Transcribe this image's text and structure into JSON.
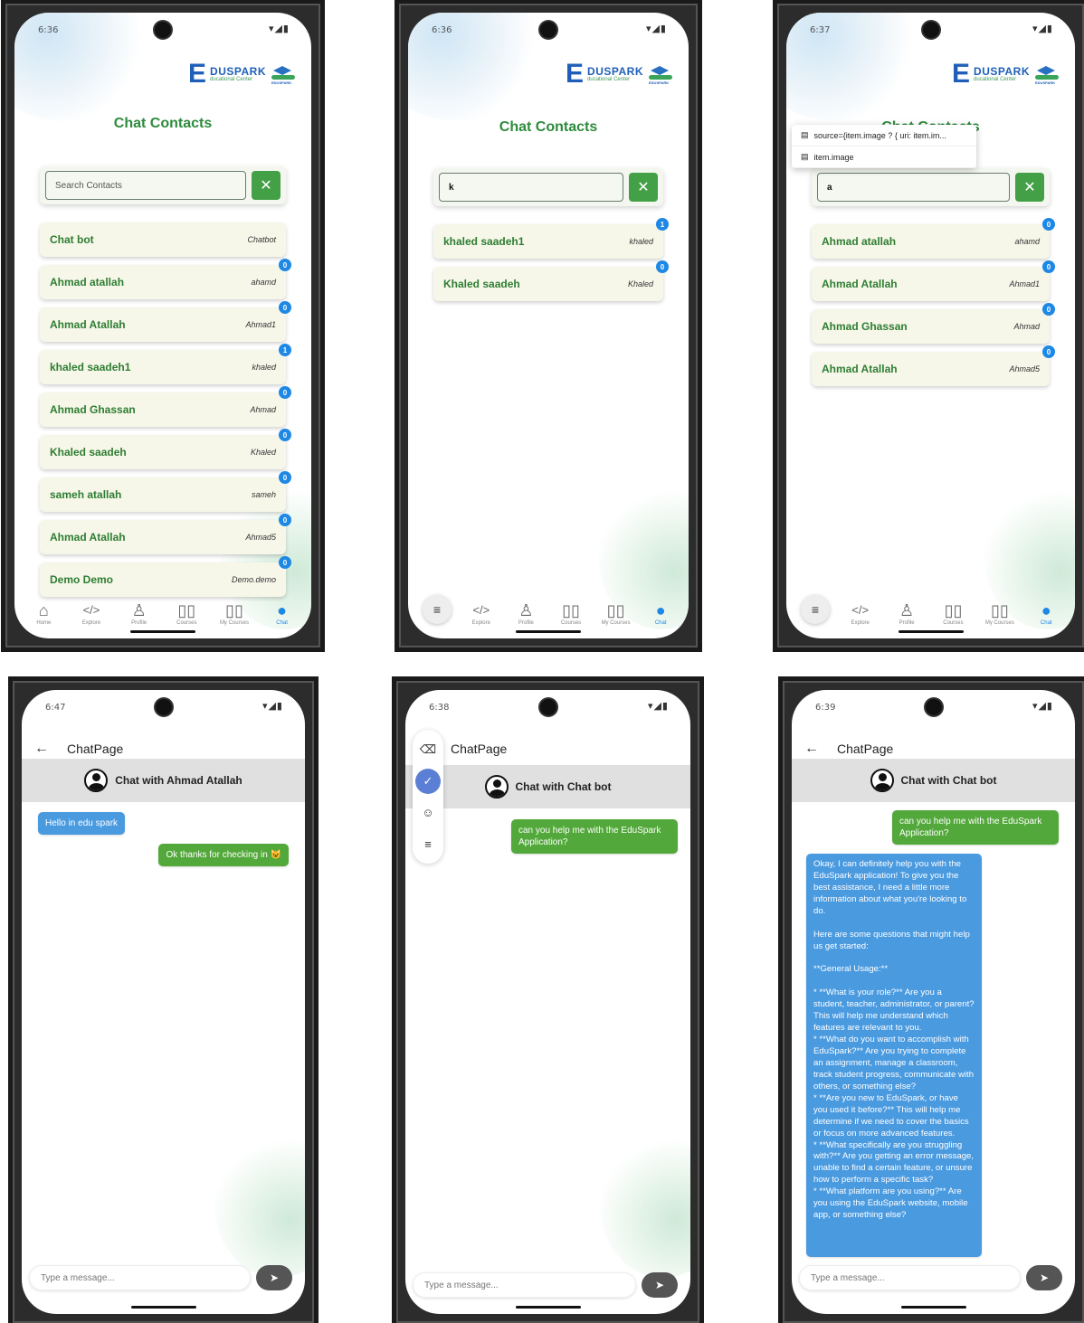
{
  "brand": {
    "letter": "E",
    "name": "DUSPARK",
    "tag": "ducational Center",
    "hat_text": "EDUSPARK"
  },
  "contacts_title": "Chat Contacts",
  "nav": [
    "Home",
    "Explore",
    "Profile",
    "Courses",
    "My Courses",
    "Chat"
  ],
  "phone1": {
    "time": "6:36",
    "search_placeholder": "Search Contacts",
    "contacts": [
      {
        "name": "Chat bot",
        "user": "Chatbot",
        "badge": null
      },
      {
        "name": "Ahmad atallah",
        "user": "ahamd",
        "badge": "0"
      },
      {
        "name": "Ahmad Atallah",
        "user": "Ahmad1",
        "badge": "0"
      },
      {
        "name": "khaled saadeh1",
        "user": "khaled",
        "badge": "1"
      },
      {
        "name": "Ahmad Ghassan",
        "user": "Ahmad",
        "badge": "0"
      },
      {
        "name": "Khaled saadeh",
        "user": "Khaled",
        "badge": "0"
      },
      {
        "name": "sameh atallah",
        "user": "sameh",
        "badge": "0"
      },
      {
        "name": "Ahmad Atallah",
        "user": "Ahmad5",
        "badge": "0"
      },
      {
        "name": "Demo Demo",
        "user": "Demo.demo",
        "badge": "0"
      }
    ]
  },
  "phone2": {
    "time": "6:36",
    "search_value": "k",
    "contacts": [
      {
        "name": "khaled saadeh1",
        "user": "khaled",
        "badge": "1"
      },
      {
        "name": "Khaled saadeh",
        "user": "Khaled",
        "badge": "0"
      }
    ]
  },
  "phone3": {
    "time": "6:37",
    "search_value": "a",
    "popup": [
      "source={item.image ? { uri: item.im...",
      "item.image"
    ],
    "contacts": [
      {
        "name": "Ahmad atallah",
        "user": "ahamd",
        "badge": "0"
      },
      {
        "name": "Ahmad Atallah",
        "user": "Ahmad1",
        "badge": "0"
      },
      {
        "name": "Ahmad Ghassan",
        "user": "Ahmad",
        "badge": "0"
      },
      {
        "name": "Ahmad Atallah",
        "user": "Ahmad5",
        "badge": "0"
      }
    ]
  },
  "chat_title": "ChatPage",
  "input_placeholder": "Type a message...",
  "phone4": {
    "time": "6:47",
    "with": "Chat with Ahmad Atallah",
    "msg_in": "Hello in edu spark",
    "msg_out": "Ok thanks for checking in 😺"
  },
  "phone5": {
    "time": "6:38",
    "with": "Chat with Chat bot",
    "msg_out": "can you help me with the EduSpark Application?"
  },
  "phone6": {
    "time": "6:39",
    "with": "Chat with Chat bot",
    "msg_out": "can you help me with the EduSpark Application?",
    "msg_in": "Okay, I can definitely help you with the EduSpark application! To give you the best assistance, I need a little more information about what you're looking to do.\n\nHere are some questions that might help us get started:\n\n**General Usage:**\n\n* **What is your role?** Are you a student, teacher, administrator, or parent? This will help me understand which features are relevant to you.\n* **What do you want to accomplish with EduSpark?** Are you trying to complete an assignment, manage a classroom, track student progress, communicate with others, or something else?\n* **Are you new to EduSpark, or have you used it before?** This will help me determine if we need to cover the basics or focus on more advanced features.\n* **What specifically are you struggling with?** Are you getting an error message, unable to find a certain feature, or unsure how to perform a specific task?\n* **What platform are you using?** Are you using the EduSpark website, mobile app, or something else?"
  }
}
